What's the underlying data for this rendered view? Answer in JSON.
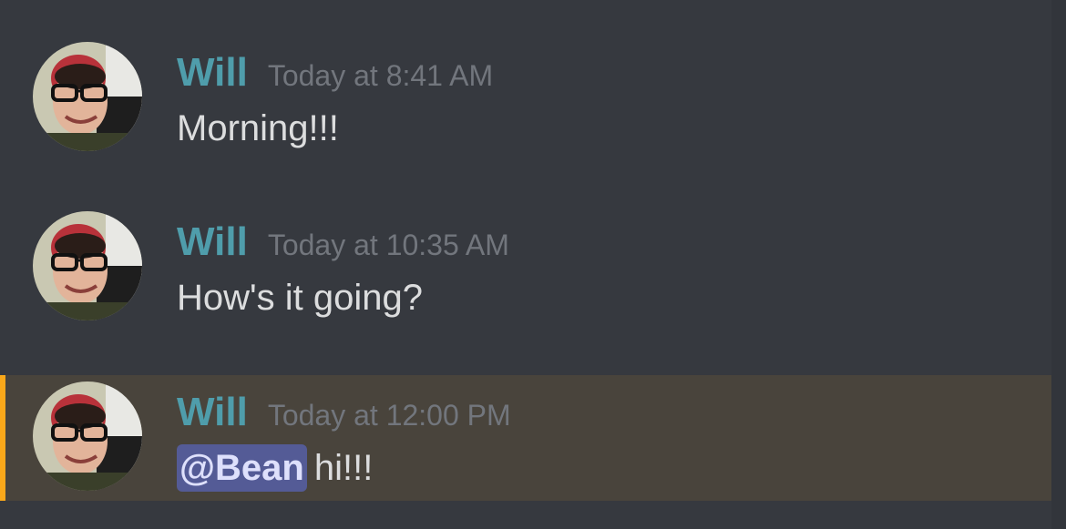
{
  "messages": [
    {
      "author": "Will",
      "timestamp": "Today at 8:41 AM",
      "text": "Morning!!!"
    },
    {
      "author": "Will",
      "timestamp": "Today at 10:35 AM",
      "text": "How's it going?"
    },
    {
      "author": "Will",
      "timestamp": "Today at 12:00 PM",
      "mention": "@Bean",
      "text": "hi!!!",
      "highlighted": true
    }
  ],
  "colors": {
    "background": "#36393f",
    "username": "#4f9dab",
    "timestamp": "#72767d",
    "message_text": "#dcddde",
    "mention_background": "#545b96",
    "mention_text": "#dee0fc",
    "highlight_background": "#49443c",
    "highlight_accent": "#faa81a"
  },
  "icons": {
    "avatar": "user-avatar-photo"
  }
}
